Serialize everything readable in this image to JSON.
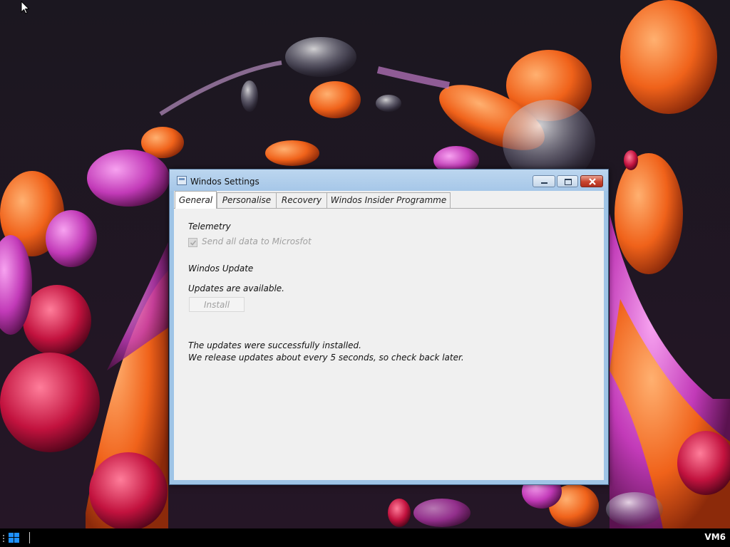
{
  "window": {
    "title": "Windos Settings",
    "tabs": [
      {
        "label": "General",
        "selected": true
      },
      {
        "label": "Personalise",
        "selected": false
      },
      {
        "label": "Recovery",
        "selected": false
      },
      {
        "label": "Windos Insider Programme",
        "selected": false
      }
    ]
  },
  "general": {
    "telemetry_heading": "Telemetry",
    "telemetry_checkbox_label": "Send all data to Microsfot",
    "telemetry_checked": true,
    "update_heading": "Windos Update",
    "update_status": "Updates are available.",
    "install_label": "Install",
    "message_line1": "The updates were successfully installed.",
    "message_line2": "We release updates about every 5 seconds, so check back later."
  },
  "taskbar": {
    "label": "VM6"
  },
  "colors": {
    "titlebar": "#a6c7e8",
    "close_button": "#c8452f",
    "client_bg": "#f0f0f0",
    "taskbar": "#000000"
  }
}
